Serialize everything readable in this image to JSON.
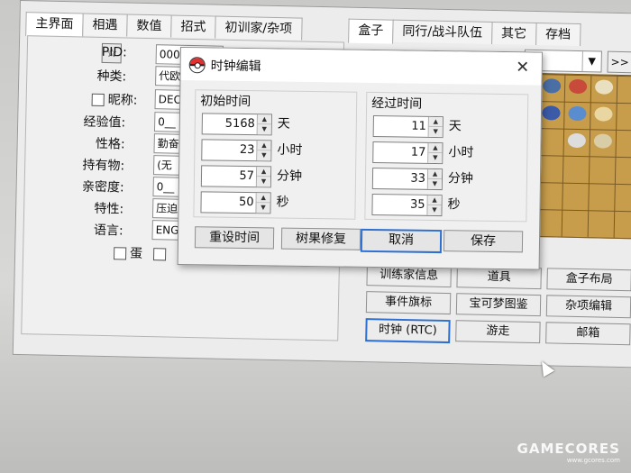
{
  "main_window": {
    "left_tabs": [
      "主界面",
      "相遇",
      "数值",
      "招式",
      "初训家/杂项"
    ],
    "right_tabs": [
      "盒子",
      "同行/战斗队伍",
      "其它",
      "存档"
    ],
    "star_button": "☆",
    "fields": [
      {
        "label": "PID:",
        "value": "000"
      },
      {
        "label": "种类:",
        "value": "代欧"
      },
      {
        "label": "昵称:",
        "value": "DEO"
      },
      {
        "label": "经验值:",
        "value": "0__"
      },
      {
        "label": "性格:",
        "value": "勤奋"
      },
      {
        "label": "持有物:",
        "value": "(无"
      },
      {
        "label": "亲密度:",
        "value": "0__"
      },
      {
        "label": "特性:",
        "value": "压迫"
      },
      {
        "label": "语言:",
        "value": "ENG"
      }
    ],
    "egg_label": "蛋",
    "nav_next": ">>",
    "right_buttons": [
      [
        "训练家信息",
        "道具",
        "盒子布局"
      ],
      [
        "事件旗标",
        "宝可梦图鉴",
        "杂项编辑"
      ],
      [
        "时钟 (RTC)",
        "游走",
        "邮箱"
      ]
    ]
  },
  "dialog": {
    "title": "时钟编辑",
    "close_symbol": "✕",
    "initial": {
      "heading": "初始时间",
      "rows": [
        {
          "value": "5168",
          "unit": "天"
        },
        {
          "value": "23",
          "unit": "小时"
        },
        {
          "value": "57",
          "unit": "分钟"
        },
        {
          "value": "50",
          "unit": "秒"
        }
      ]
    },
    "elapsed": {
      "heading": "经过时间",
      "rows": [
        {
          "value": "11",
          "unit": "天"
        },
        {
          "value": "17",
          "unit": "小时"
        },
        {
          "value": "33",
          "unit": "分钟"
        },
        {
          "value": "35",
          "unit": "秒"
        }
      ]
    },
    "buttons": {
      "reset_time": "重设时间",
      "berry_fix": "树果修复",
      "cancel": "取消",
      "save": "保存"
    }
  },
  "watermark": {
    "main": "GAMECORES",
    "sub": "www.gcores.com"
  },
  "colors": {
    "focus_blue": "#2d6fd1",
    "box_tan": "#c79d4b"
  }
}
